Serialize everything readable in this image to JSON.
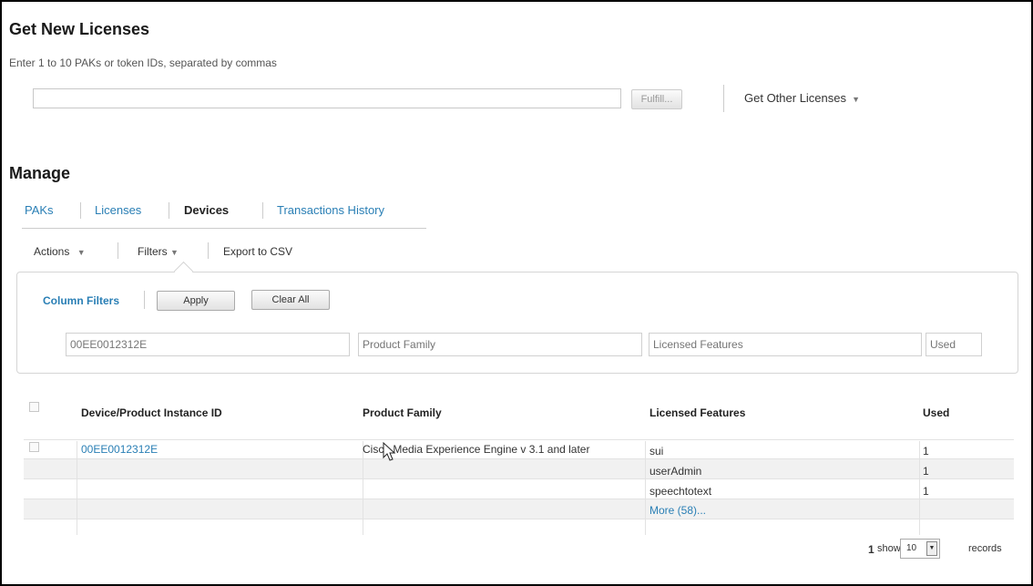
{
  "get_new": {
    "title": "Get New Licenses",
    "hint": "Enter 1 to 10 PAKs or token IDs, separated by commas",
    "input_value": "",
    "fulfill_label": "Fulfill...",
    "other_label": "Get Other Licenses"
  },
  "manage": {
    "title": "Manage",
    "tabs": [
      {
        "label": "PAKs"
      },
      {
        "label": "Licenses"
      },
      {
        "label": "Devices"
      },
      {
        "label": "Transactions History"
      }
    ],
    "toolbar": {
      "actions": "Actions",
      "filters": "Filters",
      "export": "Export to CSV"
    }
  },
  "filters": {
    "label": "Column Filters",
    "apply": "Apply",
    "clear": "Clear All",
    "device_value": "00EE0012312E",
    "family_placeholder": "Product Family",
    "features_placeholder": "Licensed Features",
    "used_placeholder": "Used"
  },
  "table": {
    "headers": {
      "device": "Device/Product Instance ID",
      "family": "Product Family",
      "features": "Licensed Features",
      "used": "Used"
    },
    "device_id": "00EE0012312E",
    "family": "Cisco Media Experience Engine v 3.1 and later",
    "features": [
      {
        "name": "sui",
        "used": "1"
      },
      {
        "name": "userAdmin",
        "used": "1"
      },
      {
        "name": "speechtotext",
        "used": "1"
      }
    ],
    "more": "More (58)..."
  },
  "pager": {
    "page": "1",
    "show": "show",
    "size": "10",
    "records": "records"
  }
}
